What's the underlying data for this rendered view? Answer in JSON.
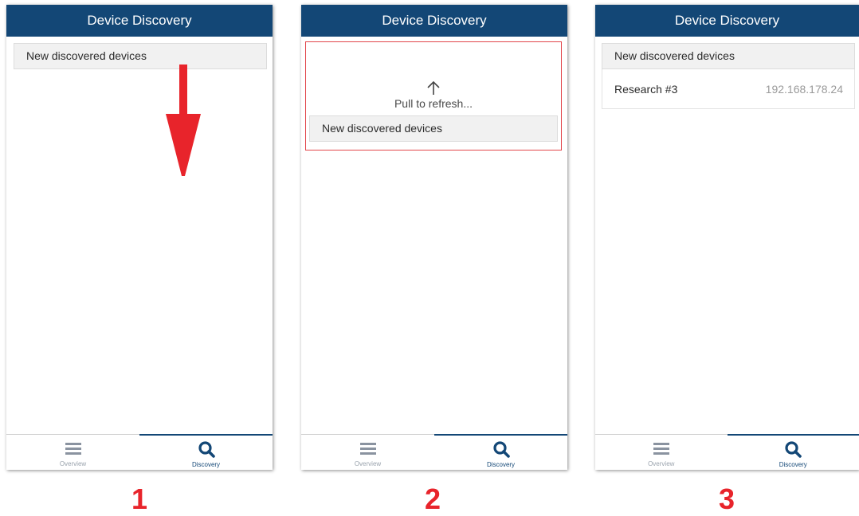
{
  "colors": {
    "header_bg": "#134776",
    "accent_red": "#e8242b"
  },
  "screens": [
    {
      "title": "Device Discovery",
      "section_header": "New discovered devices",
      "nav": {
        "overview_label": "Overview",
        "overview_icon": "hamburger-icon",
        "discovery_label": "Discovery",
        "discovery_icon": "search-icon",
        "active_tab": "Discovery"
      },
      "annotation_icon": "down-arrow-icon",
      "step": "1"
    },
    {
      "title": "Device Discovery",
      "refresh_icon": "up-arrow-icon",
      "refresh_text": "Pull to refresh...",
      "section_header": "New discovered devices",
      "nav": {
        "overview_label": "Overview",
        "overview_icon": "hamburger-icon",
        "discovery_label": "Discovery",
        "discovery_icon": "search-icon",
        "active_tab": "Discovery"
      },
      "step": "2"
    },
    {
      "title": "Device Discovery",
      "section_header": "New discovered devices",
      "devices": [
        {
          "name": "Research #3",
          "ip": "192.168.178.24"
        }
      ],
      "nav": {
        "overview_label": "Overview",
        "overview_icon": "hamburger-icon",
        "discovery_label": "Discovery",
        "discovery_icon": "search-icon",
        "active_tab": "Discovery"
      },
      "step": "3"
    }
  ]
}
